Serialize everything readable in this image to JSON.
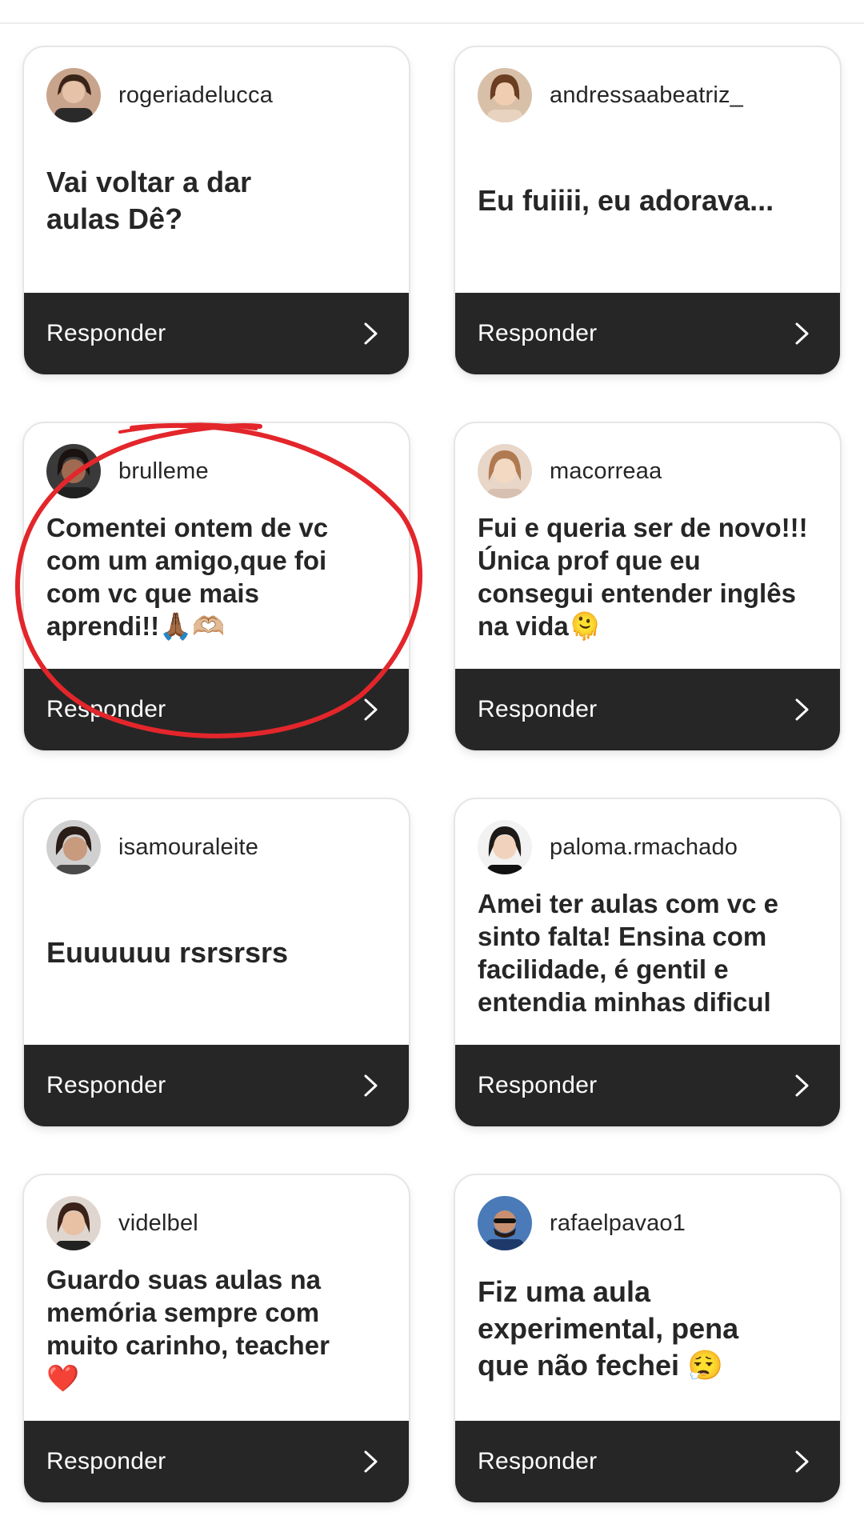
{
  "comments": [
    {
      "username": "rogeriadelucca",
      "message": "Vai voltar a dar aulas Dê?",
      "reply_label": "Responder"
    },
    {
      "username": "andressaabeatriz_",
      "message": "Eu fuiiii, eu adorava...",
      "reply_label": "Responder"
    },
    {
      "username": "brulleme",
      "message": "Comentei ontem de vc com um amigo,que foi com vc que mais aprendi!!🙏🏾🫶🏼",
      "reply_label": "Responder"
    },
    {
      "username": "macorreaa",
      "message": "Fui e queria ser de novo!!! Única prof que eu consegui entender inglês na vida🫠",
      "reply_label": "Responder"
    },
    {
      "username": "isamouraleite",
      "message": "Euuuuuu rsrsrsrs",
      "reply_label": "Responder"
    },
    {
      "username": "paloma.rmachado",
      "message": "Amei ter aulas com vc e sinto falta! Ensina com facilidade, é gentil e entendia minhas dificul",
      "reply_label": "Responder"
    },
    {
      "username": "videlbel",
      "message": "Guardo suas aulas na memória sempre com muito carinho, teacher ❤️",
      "reply_label": "Responder"
    },
    {
      "username": "rafaelpavao1",
      "message": "Fiz uma aula experimental,  pena que não fechei 😮‍💨",
      "reply_label": "Responder"
    }
  ],
  "icons": {
    "reply_chevron": "chevron-right-icon",
    "annotation": "red-circle-annotation"
  },
  "colors": {
    "reply_bar": "#262626",
    "annotation": "#e3262b"
  }
}
